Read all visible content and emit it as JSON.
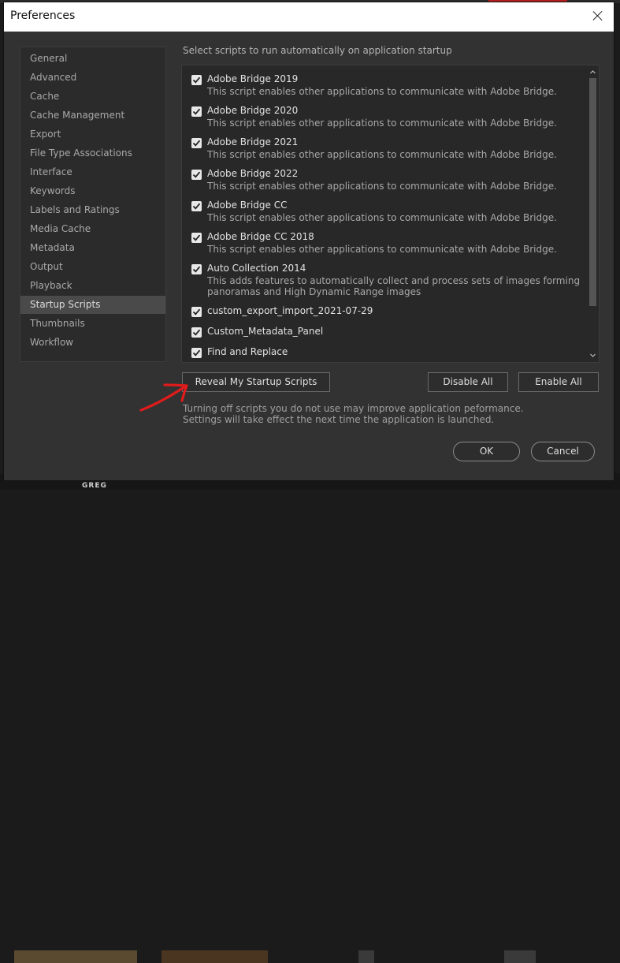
{
  "window": {
    "title": "Preferences"
  },
  "sidebar": {
    "items": [
      {
        "label": "General"
      },
      {
        "label": "Advanced"
      },
      {
        "label": "Cache"
      },
      {
        "label": "Cache Management"
      },
      {
        "label": "Export"
      },
      {
        "label": "File Type Associations"
      },
      {
        "label": "Interface"
      },
      {
        "label": "Keywords"
      },
      {
        "label": "Labels and Ratings"
      },
      {
        "label": "Media Cache"
      },
      {
        "label": "Metadata"
      },
      {
        "label": "Output"
      },
      {
        "label": "Playback"
      },
      {
        "label": "Startup Scripts"
      },
      {
        "label": "Thumbnails"
      },
      {
        "label": "Workflow"
      }
    ],
    "selected": "Startup Scripts"
  },
  "main": {
    "heading": "Select scripts to run automatically on application startup",
    "scripts": [
      {
        "name": "Adobe Bridge 2019",
        "checked": true,
        "desc": "This script enables other applications to communicate with Adobe Bridge.",
        "desc2": ""
      },
      {
        "name": "Adobe Bridge 2020",
        "checked": true,
        "desc": "This script enables other applications to communicate with Adobe Bridge.",
        "desc2": ""
      },
      {
        "name": "Adobe Bridge 2021",
        "checked": true,
        "desc": "This script enables other applications to communicate with Adobe Bridge.",
        "desc2": ""
      },
      {
        "name": "Adobe Bridge 2022",
        "checked": true,
        "desc": "This script enables other applications to communicate with Adobe Bridge.",
        "desc2": ""
      },
      {
        "name": "Adobe Bridge CC",
        "checked": true,
        "desc": "This script enables other applications to communicate with Adobe Bridge.",
        "desc2": ""
      },
      {
        "name": "Adobe Bridge CC 2018",
        "checked": true,
        "desc": "This script enables other applications to communicate with Adobe Bridge.",
        "desc2": ""
      },
      {
        "name": "Auto Collection 2014",
        "checked": true,
        "desc": "This adds features to automatically collect and process sets of images forming",
        "desc2": "panoramas and High Dynamic Range images"
      },
      {
        "name": "custom_export_import_2021-07-29",
        "checked": true,
        "desc": "",
        "desc2": ""
      },
      {
        "name": "Custom_Metadata_Panel",
        "checked": true,
        "desc": "",
        "desc2": ""
      },
      {
        "name": "Find and Replace",
        "checked": true,
        "desc": "",
        "desc2": ""
      }
    ],
    "reveal_button": "Reveal My Startup Scripts",
    "disable_all_button": "Disable All",
    "enable_all_button": "Enable All",
    "note": "Turning off scripts you do not use may improve application peformance. Settings will take effect the next time the application is launched."
  },
  "footer": {
    "ok_button": "OK",
    "cancel_button": "Cancel"
  },
  "background": {
    "thumbnail_label": "GREG"
  },
  "colors": {
    "dialog_bg": "#323232",
    "panel_bg": "#282828",
    "selected_item": "#4a4a4a",
    "annotation_arrow": "#e01b1b"
  }
}
